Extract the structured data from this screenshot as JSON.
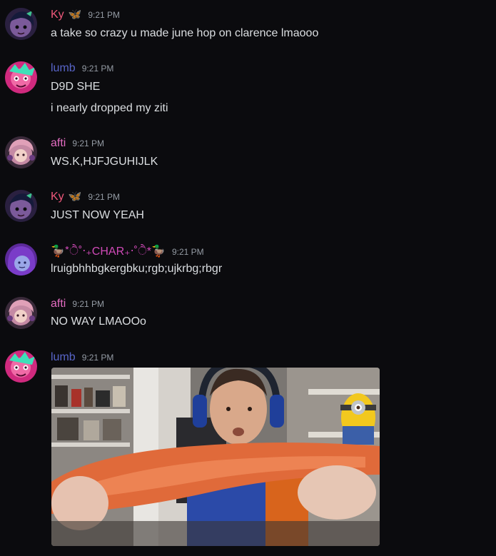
{
  "colors": {
    "background": "#0b0b0e",
    "text": "#dbdee1",
    "timestamp": "#949ba4",
    "user_ky": "#f0587b",
    "user_lumb": "#5865c8",
    "user_afti": "#e46cc2",
    "user_char": "#d04ab8"
  },
  "messages": [
    {
      "username": "Ky",
      "badge_icon": "butterfly-icon",
      "badge": "🦋",
      "time": "9:21 PM",
      "lines": [
        "a take so crazy u made june hop on clarence lmaooo"
      ]
    },
    {
      "username": "lumb",
      "time": "9:21 PM",
      "lines": [
        "D9D SHE",
        "i nearly dropped my ziti"
      ]
    },
    {
      "username": "afti",
      "time": "9:21 PM",
      "lines": [
        "WS.K,HJFJGUHIJLK"
      ]
    },
    {
      "username": "Ky",
      "badge_icon": "butterfly-icon",
      "badge": "🦋",
      "time": "9:21 PM",
      "lines": [
        "JUST NOW YEAH"
      ]
    },
    {
      "username": "🦆*ੈ˚‧₊CHAR₊‧˚ੈ*🦆",
      "time": "9:21 PM",
      "lines": [
        "lruigbhhbgkergbku;rgb;ujkrbg;rbgr"
      ]
    },
    {
      "username": "afti",
      "time": "9:21 PM",
      "lines": [
        "NO WAY LMAOOo"
      ]
    },
    {
      "username": "lumb",
      "time": "9:21 PM",
      "attachment": "image-attachment"
    }
  ]
}
